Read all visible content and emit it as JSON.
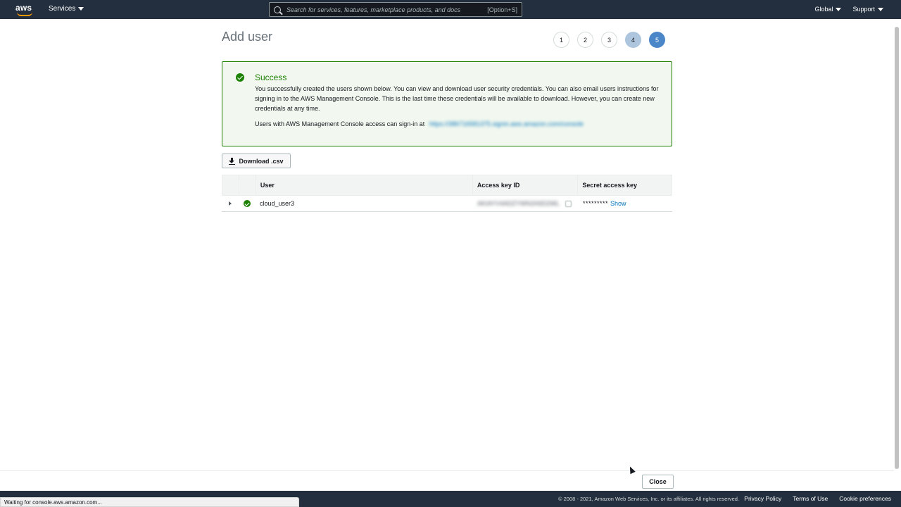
{
  "nav": {
    "services_label": "Services",
    "search_placeholder": "Search for services, features, marketplace products, and docs",
    "search_shortcut": "[Option+S]",
    "region_label": "Global",
    "support_label": "Support"
  },
  "page": {
    "title": "Add user",
    "steps": [
      "1",
      "2",
      "3",
      "4",
      "5"
    ],
    "current_step": 5
  },
  "alert": {
    "title": "Success",
    "body": "You successfully created the users shown below. You can view and download user security credentials. You can also email users instructions for signing in to the AWS Management Console. This is the last time these credentials will be available to download. However, you can create new credentials at any time.",
    "signin_text": "Users with AWS Management Console access can sign-in at",
    "signin_url": "https://386716581375.signin.aws.amazon.com/console"
  },
  "download_label": "Download .csv",
  "table": {
    "headers": [
      "",
      "",
      "User",
      "Access key ID",
      "Secret access key"
    ],
    "rows": [
      {
        "user": "cloud_user3",
        "access_key_id": "AKIAYV4ADZYWN3X6D2WL",
        "secret_mask": "*********",
        "show_label": "Show"
      }
    ]
  },
  "close_label": "Close",
  "footer": {
    "copyright": "© 2008 - 2021, Amazon Web Services, Inc. or its affiliates. All rights reserved.",
    "links": [
      "Privacy Policy",
      "Terms of Use",
      "Cookie preferences"
    ]
  },
  "status_bar": "Waiting for console.aws.amazon.com..."
}
